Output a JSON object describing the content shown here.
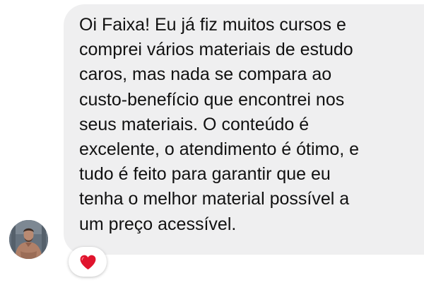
{
  "message": {
    "lines": [
      "Oi Faixa! Eu já fiz muitos cursos e",
      "comprei vários materiais de estudo",
      "caros, mas nada se compara ao",
      "custo-benefício que encontrei nos",
      "seus materiais. O conteúdo é",
      "excelente, o atendimento é ótimo, e",
      "tudo é feito para garantir que eu",
      "tenha o melhor material possível a",
      "um preço acessível."
    ]
  },
  "reaction": {
    "icon": "heart-icon",
    "color": "#e0142d"
  },
  "colors": {
    "bubble": "#efeff0",
    "text": "#111111"
  }
}
